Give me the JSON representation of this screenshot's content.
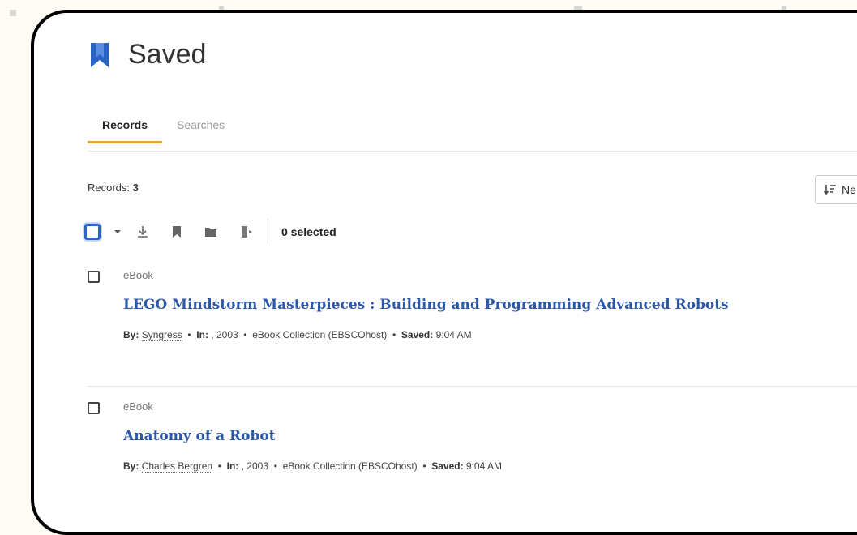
{
  "page": {
    "title": "Saved"
  },
  "tabs": [
    {
      "label": "Records"
    },
    {
      "label": "Searches"
    }
  ],
  "records_count": {
    "label": "Records:",
    "value": "3"
  },
  "sort": {
    "label": "Ne"
  },
  "toolbar": {
    "selected_text": "0 selected"
  },
  "records": [
    {
      "type": "eBook",
      "title": "LEGO Mindstorm Masterpieces : Building and Programming Advanced Robots",
      "by_label": "By:",
      "author": "Syngress",
      "in_label": "In:",
      "in_value": ", 2003",
      "collection": "eBook Collection (EBSCOhost)",
      "saved_label": "Saved:",
      "saved_value": "9:04 AM"
    },
    {
      "type": "eBook",
      "title": "Anatomy of a Robot",
      "by_label": "By:",
      "author": "Charles Bergren",
      "in_label": "In:",
      "in_value": ", 2003",
      "collection": "eBook Collection (EBSCOhost)",
      "saved_label": "Saved:",
      "saved_value": "9:04 AM"
    }
  ],
  "colors": {
    "accent_tab": "#e9a13a",
    "link": "#2d59a8",
    "bookmark_icon": "#2a64c5"
  }
}
